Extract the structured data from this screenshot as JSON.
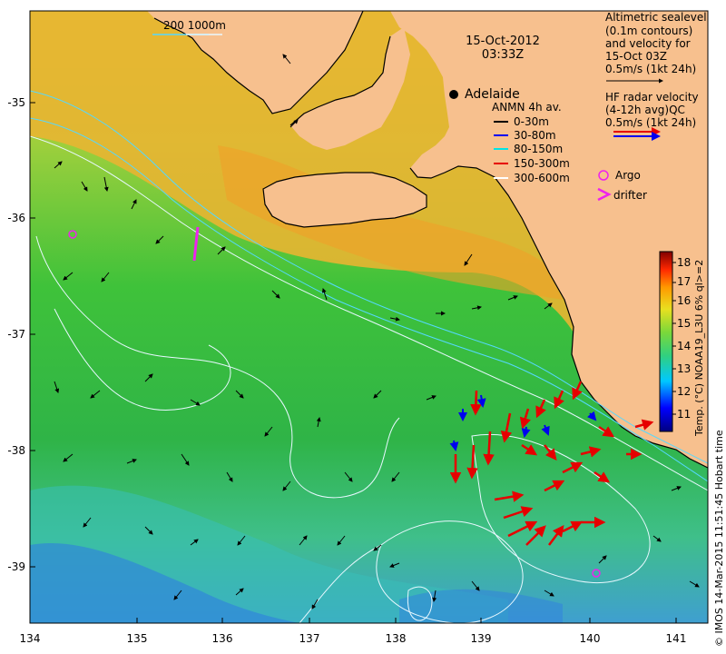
{
  "title": {
    "date": "15-Oct-2012",
    "time": "03:33Z"
  },
  "scalebar": {
    "label": "200  1000m"
  },
  "city": {
    "name": "Adelaide"
  },
  "axes": {
    "x_ticks": [
      "134",
      "135",
      "136",
      "137",
      "138",
      "139",
      "140",
      "141"
    ],
    "y_ticks": [
      "-35",
      "-36",
      "-37",
      "-38",
      "-39"
    ]
  },
  "legend_altimetry": {
    "lines": [
      "Altimetric sealevel",
      "(0.1m contours)",
      "and velocity for",
      "15-Oct 03Z",
      "0.5m/s (1kt 24h)"
    ]
  },
  "legend_hf": {
    "lines": [
      "HF radar velocity",
      "(4-12h avg)QC",
      "0.5m/s (1kt 24h)"
    ]
  },
  "legend_anmn": {
    "title": "ANMN 4h av.",
    "items": [
      {
        "label": "0-30m",
        "color": "#000000"
      },
      {
        "label": "30-80m",
        "color": "#0000ee"
      },
      {
        "label": "80-150m",
        "color": "#00e5e5"
      },
      {
        "label": "150-300m",
        "color": "#e60000"
      },
      {
        "label": "300-600m",
        "color": "#ffffff"
      }
    ]
  },
  "legend_markers": {
    "argo": "Argo",
    "drifter": "drifter",
    "argo_color": "#ee22ee",
    "drifter_color": "#ee22ee"
  },
  "colorbar": {
    "ticks": [
      "11",
      "12",
      "13",
      "14",
      "15",
      "16",
      "17",
      "18"
    ],
    "label": "Temp. (°C) NOAA19_L3U 6% ql>=2",
    "vmin": 10.5,
    "vmax": 18.5
  },
  "credit": "© IMOS 14-Mar-2015 11:51:45 Hobart time",
  "colors": {
    "land": "#f7c08e",
    "argo": "#ee22ee"
  }
}
